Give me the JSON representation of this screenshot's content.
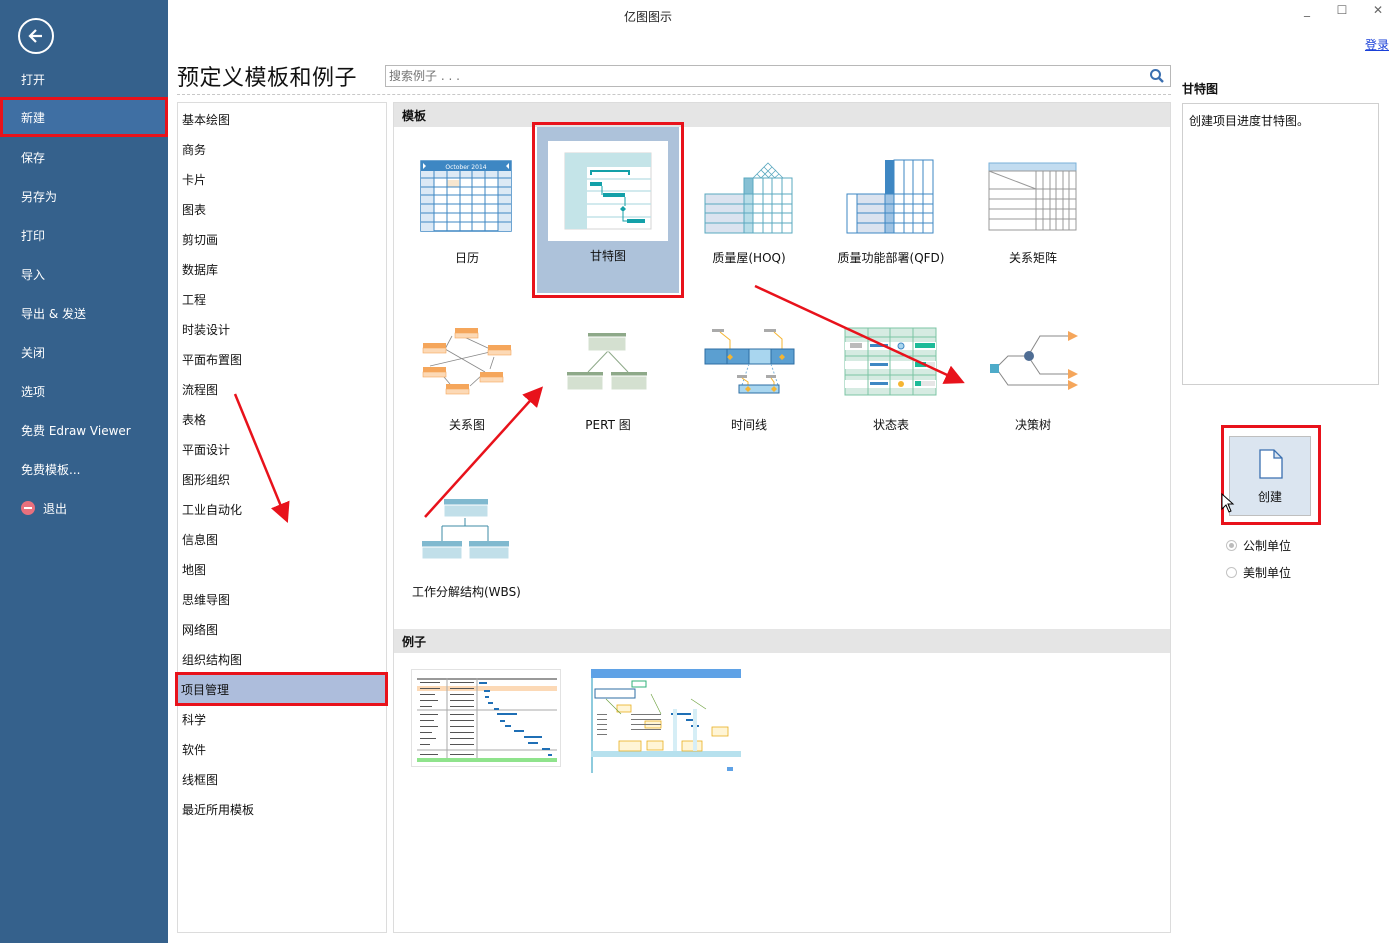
{
  "window": {
    "title": "亿图图示",
    "minimize": "_",
    "maximize": "☐",
    "close": "✕",
    "login": "登录"
  },
  "nav": {
    "back_icon": "back-arrow-icon",
    "items": [
      {
        "label": "打开"
      },
      {
        "label": "新建",
        "active": true
      },
      {
        "label": "保存"
      },
      {
        "label": "另存为"
      },
      {
        "label": "打印"
      },
      {
        "label": "导入"
      },
      {
        "label": "导出 & 发送"
      },
      {
        "label": "关闭"
      },
      {
        "label": "选项"
      },
      {
        "label": "免费 Edraw Viewer"
      },
      {
        "label": "免费模板..."
      },
      {
        "label": "退出",
        "icon": "exit-icon"
      }
    ]
  },
  "header": {
    "title": "预定义模板和例子",
    "search_placeholder": "搜索例子 . . ."
  },
  "categories": [
    "基本绘图",
    "商务",
    "卡片",
    "图表",
    "剪切画",
    "数据库",
    "工程",
    "时装设计",
    "平面布置图",
    "流程图",
    "表格",
    "平面设计",
    "图形组织",
    "工业自动化",
    "信息图",
    "地图",
    "思维导图",
    "网络图",
    "组织结构图",
    "项目管理",
    "科学",
    "软件",
    "线框图",
    "最近所用模板"
  ],
  "selected_category": "项目管理",
  "main": {
    "templates_header": "模板",
    "examples_header": "例子",
    "templates": [
      {
        "label": "日历",
        "icon": "calendar-thumbnail",
        "calendar_caption": "October 2014"
      },
      {
        "label": "甘特图",
        "icon": "gantt-thumbnail",
        "selected": true
      },
      {
        "label": "质量屋(HOQ)",
        "icon": "hoq-thumbnail"
      },
      {
        "label": "质量功能部署(QFD)",
        "icon": "qfd-thumbnail"
      },
      {
        "label": "关系矩阵",
        "icon": "relation-matrix-thumbnail"
      },
      {
        "label": "关系图",
        "icon": "relation-diagram-thumbnail"
      },
      {
        "label": "PERT 图",
        "icon": "pert-thumbnail"
      },
      {
        "label": "时间线",
        "icon": "timeline-thumbnail"
      },
      {
        "label": "状态表",
        "icon": "status-table-thumbnail"
      },
      {
        "label": "决策树",
        "icon": "decision-tree-thumbnail"
      },
      {
        "label": "工作分解结构(WBS)",
        "icon": "wbs-thumbnail"
      }
    ],
    "examples": [
      {
        "icon": "gantt-example-thumbnail"
      },
      {
        "icon": "gantt-annotated-example-thumbnail"
      }
    ]
  },
  "right": {
    "title": "甘特图",
    "description": "创建项目进度甘特图。",
    "create_label": "创建",
    "units": [
      {
        "label": "公制单位",
        "checked": true
      },
      {
        "label": "美制单位",
        "checked": false
      }
    ]
  },
  "colors": {
    "nav_bg": "#35618c",
    "nav_active": "#3f6fa3",
    "highlight_red": "#e8121b",
    "selected_bg": "#adbddc",
    "link_blue": "#1a40d8",
    "section_head": "#e5e5e5"
  }
}
